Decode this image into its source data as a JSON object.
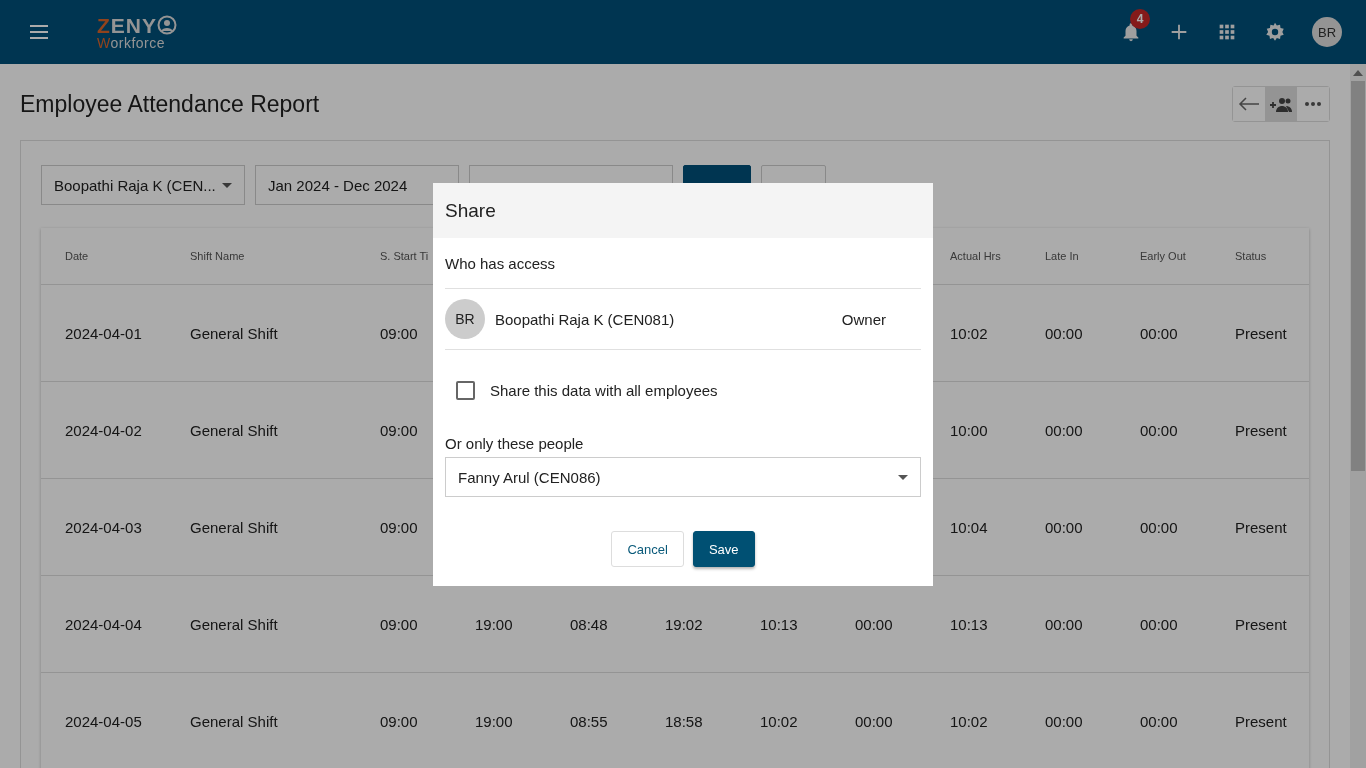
{
  "header": {
    "logo": {
      "brand_initial": "Z",
      "brand_rest": "ENY",
      "tagline_initial": "W",
      "tagline_rest": "orkforce"
    },
    "notification_count": "4",
    "avatar": "BR"
  },
  "title": "Employee Attendance Report",
  "toolbar": [
    {
      "kind": "back",
      "selected": false
    },
    {
      "kind": "share",
      "selected": true
    },
    {
      "kind": "more",
      "selected": false
    }
  ],
  "filters": {
    "employee": "Boopathi Raja K (CEN...",
    "date_range": "Jan 2024 - Dec 2024"
  },
  "table": {
    "columns": [
      "Date",
      "Shift Name",
      "S. Start Ti",
      null,
      null,
      null,
      null,
      null,
      "Actual Hrs",
      "Late In",
      "Early Out",
      "Status"
    ],
    "rows": [
      {
        "cells": [
          "2024-04-01",
          "General Shift",
          "09:00",
          null,
          null,
          null,
          null,
          null,
          "10:02",
          "00:00",
          "00:00",
          "Present"
        ]
      },
      {
        "cells": [
          "2024-04-02",
          "General Shift",
          "09:00",
          null,
          null,
          null,
          null,
          null,
          "10:00",
          "00:00",
          "00:00",
          "Present"
        ]
      },
      {
        "cells": [
          "2024-04-03",
          "General Shift",
          "09:00",
          null,
          null,
          null,
          null,
          null,
          "10:04",
          "00:00",
          "00:00",
          "Present"
        ]
      },
      {
        "cells": [
          "2024-04-04",
          "General Shift",
          "09:00",
          "19:00",
          "08:48",
          "19:02",
          "10:13",
          "00:00",
          "10:13",
          "00:00",
          "00:00",
          "Present"
        ]
      },
      {
        "cells": [
          "2024-04-05",
          "General Shift",
          "09:00",
          "19:00",
          "08:55",
          "18:58",
          "10:02",
          "00:00",
          "10:02",
          "00:00",
          "00:00",
          "Present"
        ]
      }
    ]
  },
  "dialog": {
    "title": "Share",
    "access_label": "Who has access",
    "owner": {
      "initials": "BR",
      "name": "Boopathi Raja K (CEN081)",
      "role": "Owner"
    },
    "share_all": {
      "label": "Share this data with all employees",
      "checked": false
    },
    "people_label": "Or only these people",
    "people_value": "Fanny Arul (CEN086)",
    "buttons": [
      {
        "label": "Cancel",
        "kind": "secondary"
      },
      {
        "label": "Save",
        "kind": "primary"
      }
    ]
  }
}
